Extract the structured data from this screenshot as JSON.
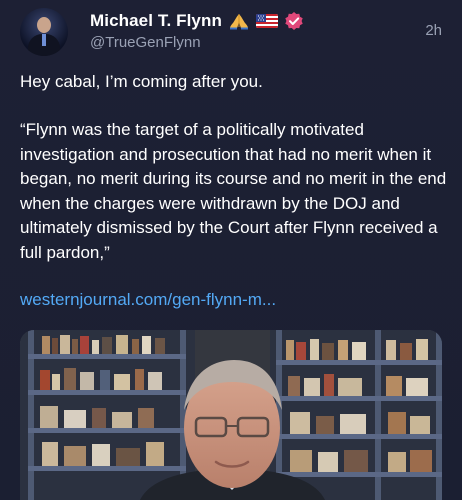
{
  "post": {
    "author": {
      "display_name": "Michael T. Flynn",
      "handle": "@TrueGenFlynn",
      "avatar_icon": "avatar-photo-icon",
      "name_emojis": [
        "praying-hands-icon",
        "us-flag-icon"
      ],
      "verified_icon": "verified-badge-icon"
    },
    "timestamp": "2h",
    "intro_text": "Hey cabal, I’m coming after you.",
    "quote_text": "“Flynn was the target of a politically motivated investigation and prosecution that had no merit when it began, no merit during its course and no merit in the end when the charges were withdrawn by the DOJ and ultimately dismissed by the Court after Flynn received a full pardon,”",
    "link_text": "westernjournal.com/gen-flynn-m...",
    "media": {
      "icon": "video-thumbnail-icon"
    }
  },
  "colors": {
    "background": "#1c2033",
    "text": "#ffffff",
    "muted": "#9aa1b4",
    "link": "#53a9f5",
    "verified_badge": "#e0487a"
  }
}
